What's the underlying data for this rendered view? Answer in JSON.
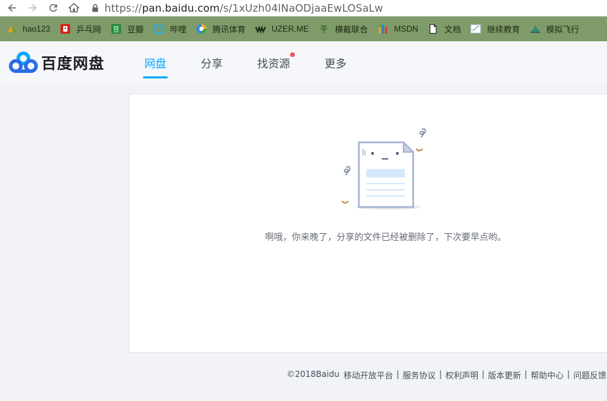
{
  "browser": {
    "url_prefix": "https://",
    "url_host": "pan.baidu.com",
    "url_path": "/s/1xUzh04lNaODjaaEwLOSaLw"
  },
  "bookmarks": [
    {
      "label": "hao123",
      "icon": "hao123-icon"
    },
    {
      "label": "乒乓网",
      "icon": "pingpang-icon"
    },
    {
      "label": "豆瓣",
      "icon": "douban-icon"
    },
    {
      "label": "哔哩",
      "icon": "bilibili-icon"
    },
    {
      "label": "腾讯体育",
      "icon": "tencent-sports-icon"
    },
    {
      "label": "UZER.ME",
      "icon": "uzer-icon"
    },
    {
      "label": "横截联合",
      "icon": "leaf-icon"
    },
    {
      "label": "MSDN",
      "icon": "msdn-icon"
    },
    {
      "label": "文档",
      "icon": "document-icon"
    },
    {
      "label": "继续教育",
      "icon": "education-icon"
    },
    {
      "label": "模拟飞行",
      "icon": "flight-icon"
    }
  ],
  "header": {
    "logo_text": "百度网盘",
    "tabs": [
      {
        "label": "网盘",
        "active": true
      },
      {
        "label": "分享",
        "active": false
      },
      {
        "label": "找资源",
        "active": false,
        "badge": true
      },
      {
        "label": "更多",
        "active": false
      }
    ]
  },
  "main": {
    "message": "啊哦，你来晚了，分享的文件已经被删除了，下次要早点哟。"
  },
  "footer": {
    "copyright": "©2018Baidu",
    "links": [
      "移动开放平台",
      "服务协议",
      "权利声明",
      "版本更新",
      "帮助中心",
      "问题反馈"
    ]
  },
  "colors": {
    "accent": "#06a7ff",
    "bookmarks_bg": "#7e9b69",
    "badge": "#f5565b"
  }
}
